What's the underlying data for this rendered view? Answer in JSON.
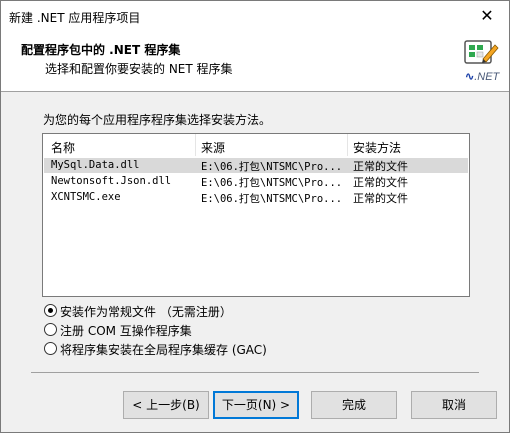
{
  "window": {
    "title": "新建 .NET 应用程序项目",
    "close_glyph": "✕"
  },
  "header": {
    "title": "配置程序包中的 .NET 程序集",
    "subtitle": "选择和配置你要安装的 NET 程序集",
    "logo_text_prefix": "",
    "logo_text": ".NET"
  },
  "instruction": "为您的每个应用程序程序集选择安装方法。",
  "listview": {
    "columns": [
      "名称",
      "来源",
      "安装方法"
    ],
    "rows": [
      {
        "name": "MySql.Data.dll",
        "source": "E:\\06.打包\\NTSMC\\Pro...",
        "method": "正常的文件",
        "selected": true
      },
      {
        "name": "Newtonsoft.Json.dll",
        "source": "E:\\06.打包\\NTSMC\\Pro...",
        "method": "正常的文件",
        "selected": false
      },
      {
        "name": "XCNTSMC.exe",
        "source": "E:\\06.打包\\NTSMC\\Pro...",
        "method": "正常的文件",
        "selected": false
      }
    ]
  },
  "options": [
    {
      "label": "安装作为常规文件 （无需注册）",
      "checked": true
    },
    {
      "label": "注册 COM 互操作程序集",
      "checked": false
    },
    {
      "label": "将程序集安装在全局程序集缓存 (GAC)",
      "checked": false
    }
  ],
  "buttons": {
    "back": "< 上一步(B)",
    "next": "下一页(N) >",
    "finish": "完成",
    "cancel": "取消"
  },
  "colors": {
    "accent": "#0078d7",
    "selected_row": "#d9d9d9"
  }
}
